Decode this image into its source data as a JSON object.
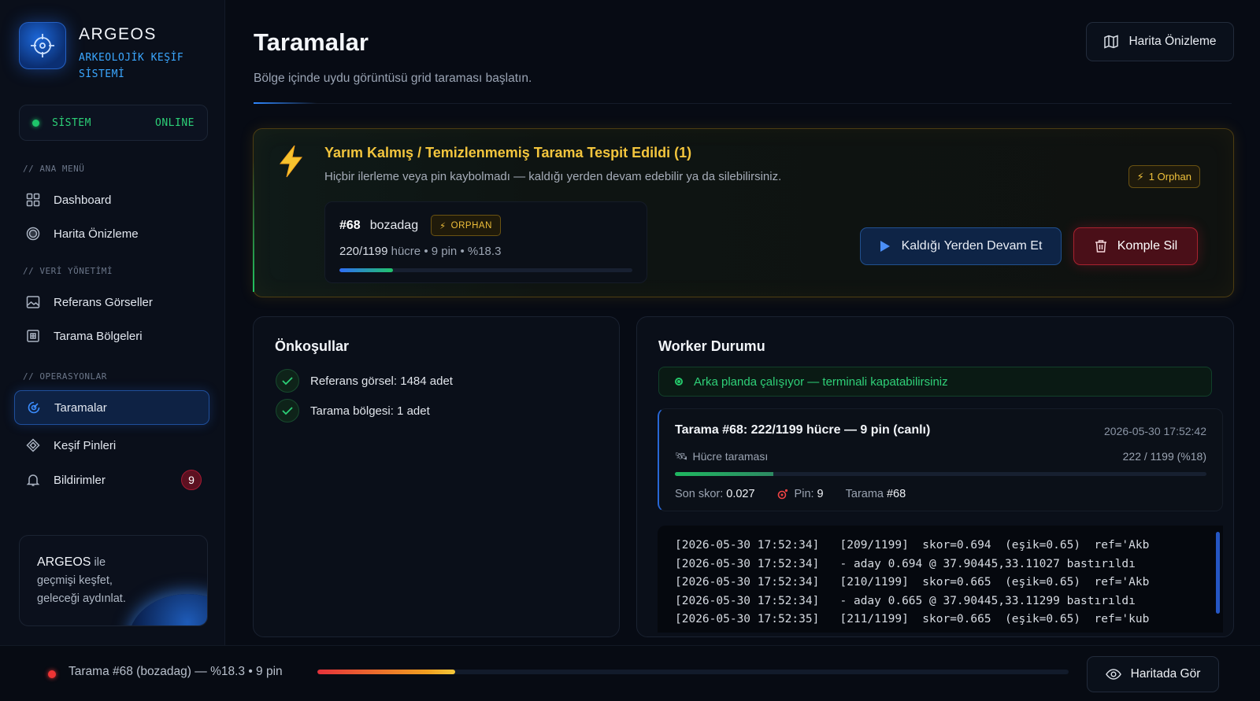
{
  "brand": {
    "name": "ARGEOS",
    "subtitle_line1": "ARKEOLOJİK KEŞİF",
    "subtitle_line2": "SİSTEMİ"
  },
  "system_status": {
    "label": "SİSTEM",
    "value": "ONLINE",
    "color": "#1ec66a"
  },
  "nav": {
    "section_main": "// ANA MENÜ",
    "section_data": "// VERİ YÖNETİMİ",
    "section_ops": "// OPERASYONLAR",
    "dashboard": "Dashboard",
    "map_preview": "Harita Önizleme",
    "reference_images": "Referans Görseller",
    "scan_regions": "Tarama Bölgeleri",
    "scans": "Taramalar",
    "discovery_pins": "Keşif Pinleri",
    "notifications": "Bildirimler",
    "notifications_count": "9",
    "active_item": "scans"
  },
  "promo": {
    "brand": "ARGEOS",
    "suffix": " ile",
    "line2": "geçmişi keşfet,",
    "line3": "geleceği aydınlat."
  },
  "page": {
    "title": "Taramalar",
    "subtitle": "Bölge içinde uydu görüntüsü grid taraması başlatın.",
    "map_button": "Harita Önizleme"
  },
  "orphan_alert": {
    "title": "Yarım Kalmış / Temizlenmemiş Tarama Tespit Edildi (1)",
    "description": "Hiçbir ilerleme veya pin kaybolmadı — kaldığı yerden devam edebilir ya da silebilirsiniz.",
    "badge": "1 Orphan",
    "scan": {
      "id": "#68",
      "name": "bozadag",
      "tag": "ORPHAN",
      "cells": "220/1199",
      "cells_unit": " hücre",
      "sep1": " • ",
      "pins": "9 pin",
      "sep2": " • ",
      "percent": "%18.3",
      "progress": 0.183
    },
    "resume_button": "Kaldığı Yerden Devam Et",
    "delete_button": "Komple Sil",
    "accent": "#f3c53d"
  },
  "prereq": {
    "title": "Önkoşullar",
    "items": [
      {
        "label": "Referans görsel: 1484 adet"
      },
      {
        "label": "Tarama bölgesi: 1 adet"
      }
    ]
  },
  "worker": {
    "title": "Worker Durumu",
    "banner": "Arka planda çalışıyor — terminali kapatabilirsiniz",
    "live": {
      "title": "Tarama #68: 222/1199 hücre — 9 pin (canlı)",
      "time": "2026-05-30 17:52:42",
      "phase": "Hücre taraması",
      "count": "222 / 1199 (%18)",
      "progress": 0.185,
      "score_label": "Son skor:",
      "score": "0.027",
      "pin_label": "Pin:",
      "pin": "9",
      "scan_label": "Tarama",
      "scan": "#68"
    },
    "log": [
      "[2026-05-30 17:52:34]   [209/1199]  skor=0.694  (eşik=0.65)  ref='Akb",
      "[2026-05-30 17:52:34]   - aday 0.694 @ 37.90445,33.11027 bastırıldı",
      "[2026-05-30 17:52:34]   [210/1199]  skor=0.665  (eşik=0.65)  ref='Akb",
      "[2026-05-30 17:52:34]   - aday 0.665 @ 37.90445,33.11299 bastırıldı",
      "[2026-05-30 17:52:35]   [211/1199]  skor=0.665  (eşik=0.65)  ref='kub"
    ]
  },
  "bottom": {
    "text": "Tarama #68 (bozadag) — %18.3 • 9 pin",
    "progress": 0.183,
    "button": "Haritada Gör"
  }
}
